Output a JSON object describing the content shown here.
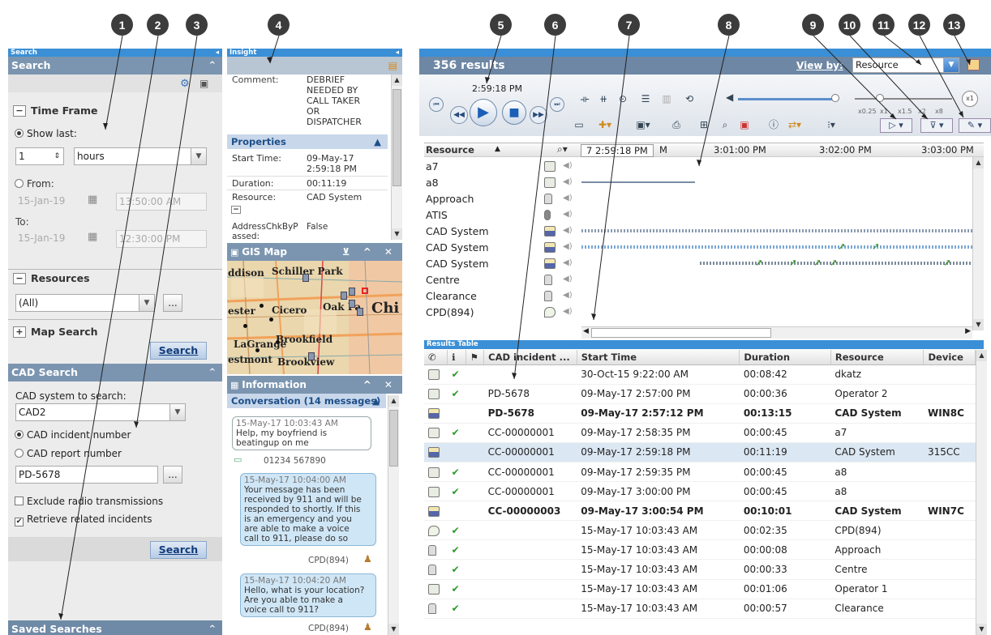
{
  "callouts": [
    "1",
    "2",
    "3",
    "4",
    "5",
    "6",
    "7",
    "8",
    "9",
    "10",
    "11",
    "12",
    "13"
  ],
  "search_pane": {
    "strip_title": "Search",
    "header": "Search",
    "time_frame": "Time Frame",
    "show_last": "Show last:",
    "show_last_value": "1",
    "show_last_unit": "hours",
    "from_label": "From:",
    "from_date": "15-Jan-19",
    "from_time": "13:50:00 AM",
    "to_label": "To:",
    "to_date": "15-Jan-19",
    "to_time": "12:30:00 PM",
    "resources": "Resources",
    "resources_value": "(All)",
    "more": "...",
    "map_search": "Map Search",
    "search_button": "Search",
    "cad_header": "CAD Search",
    "cad_system_label": "CAD system to search:",
    "cad_system_value": "CAD2",
    "incident_number": "CAD incident number",
    "report_number": "CAD report number",
    "incident_value": "PD-5678",
    "exclude_radio": "Exclude radio transmissions",
    "retrieve_related": "Retrieve related incidents",
    "saved_searches": "Saved Searches"
  },
  "insight": {
    "strip_title": "Insight",
    "comment_label": "Comment:",
    "comment_lines": [
      "DEBRIEF",
      "NEEDED BY",
      "CALL TAKER",
      "OR",
      "DISPATCHER"
    ],
    "properties": "Properties",
    "start_time_label": "Start Time:",
    "start_time": "09-May-17",
    "start_time2": "2:59:18 PM",
    "duration_label": "Duration:",
    "duration": "00:11:19",
    "resource_label": "Resource:",
    "resource": "CAD System",
    "address_label": "AddressChkByP",
    "address_label2": "assed:",
    "address_value": "False"
  },
  "gis": {
    "title": "GIS Map",
    "labels": [
      "ddison",
      "Schiller Park",
      "ester",
      "Cicero",
      "Oak Pa",
      "Chi",
      "LaGrange",
      "Brookfield",
      "estmont",
      "Brookview"
    ]
  },
  "information": {
    "title": "Information",
    "conversation": "Conversation (14 messages)",
    "messages": [
      {
        "ts": "15-May-17 10:03:43 AM",
        "text": [
          "Help, my boyfriend is",
          "beatingup on me"
        ],
        "from": "01234 567890"
      },
      {
        "ts": "15-May-17 10:04:00 AM",
        "text": [
          "Your message has been",
          "received by 911 and will be",
          "responded to shortly. If this",
          "is an emergency and you",
          "are able to make a voice",
          "call to 911, please do so"
        ],
        "from": "CPD(894)"
      },
      {
        "ts": "15-May-17 10:04:20 AM",
        "text": [
          "Hello, what is your location?",
          "Are you able to make a",
          "voice call to 911?"
        ],
        "from": "CPD(894)"
      }
    ]
  },
  "main": {
    "results": "356 results",
    "view_by_label": "View by:",
    "view_by_value": "Resource",
    "play_time": "2:59:18 PM",
    "speed_labels": [
      "x0.25",
      "x1",
      "x1.5",
      "x2",
      "x8"
    ],
    "speed_x1_button": "x1",
    "timeline_header": "Resource",
    "timeline_cursor": "7 2:59:18 PM",
    "ticks": [
      "M",
      "3:01:00 PM",
      "3:02:00 PM",
      "3:03:00 PM"
    ],
    "resources": [
      "a7",
      "a8",
      "Approach",
      "ATIS",
      "CAD System",
      "CAD System",
      "CAD System",
      "Centre",
      "Clearance",
      "CPD(894)"
    ],
    "results_table_strip": "Results Table",
    "table_headers": [
      "CAD incident ...",
      "Start Time",
      "Duration",
      "Resource",
      "Device"
    ],
    "rows": [
      {
        "icon": "radio",
        "ok": "✔",
        "incident": "",
        "start": "30-Oct-15 9:22:00 AM",
        "duration": "00:08:42",
        "resource": "dkatz",
        "device": "",
        "style": ""
      },
      {
        "icon": "radio",
        "ok": "✔",
        "incident": "PD-5678",
        "start": "09-May-17 2:57:00 PM",
        "duration": "00:00:36",
        "resource": "Operator 2",
        "device": "",
        "style": ""
      },
      {
        "icon": "cad",
        "ok": "",
        "incident": "PD-5678",
        "start": "09-May-17 2:57:12 PM",
        "duration": "00:13:15",
        "resource": "CAD System",
        "device": "WIN8C",
        "style": "bold"
      },
      {
        "icon": "radio",
        "ok": "✔",
        "incident": "CC-00000001",
        "start": "09-May-17 2:58:35 PM",
        "duration": "00:00:45",
        "resource": "a7",
        "device": "",
        "style": ""
      },
      {
        "icon": "cad",
        "ok": "",
        "incident": "CC-00000001",
        "start": "09-May-17 2:59:18 PM",
        "duration": "00:11:19",
        "resource": "CAD System",
        "device": "315CC",
        "style": "sel"
      },
      {
        "icon": "radio",
        "ok": "✔",
        "incident": "CC-00000001",
        "start": "09-May-17 2:59:35 PM",
        "duration": "00:00:45",
        "resource": "a8",
        "device": "",
        "style": ""
      },
      {
        "icon": "radio",
        "ok": "✔",
        "incident": "CC-00000001",
        "start": "09-May-17 3:00:00 PM",
        "duration": "00:00:45",
        "resource": "a8",
        "device": "",
        "style": ""
      },
      {
        "icon": "cad",
        "ok": "",
        "incident": "CC-00000003",
        "start": "09-May-17 3:00:54 PM",
        "duration": "00:10:01",
        "resource": "CAD System",
        "device": "WIN7C",
        "style": "bold"
      },
      {
        "icon": "chat",
        "ok": "✔",
        "incident": "",
        "start": "15-May-17 10:03:43 AM",
        "duration": "00:02:35",
        "resource": "CPD(894)",
        "device": "",
        "style": ""
      },
      {
        "icon": "phone",
        "ok": "✔",
        "incident": "",
        "start": "15-May-17 10:03:43 AM",
        "duration": "00:00:08",
        "resource": "Approach",
        "device": "",
        "style": ""
      },
      {
        "icon": "phone",
        "ok": "✔",
        "incident": "",
        "start": "15-May-17 10:03:43 AM",
        "duration": "00:00:33",
        "resource": "Centre",
        "device": "",
        "style": ""
      },
      {
        "icon": "radio",
        "ok": "✔",
        "incident": "",
        "start": "15-May-17 10:03:43 AM",
        "duration": "00:01:06",
        "resource": "Operator 1",
        "device": "",
        "style": ""
      },
      {
        "icon": "phone",
        "ok": "✔",
        "incident": "",
        "start": "15-May-17 10:03:43 AM",
        "duration": "00:00:57",
        "resource": "Clearance",
        "device": "",
        "style": ""
      }
    ]
  }
}
